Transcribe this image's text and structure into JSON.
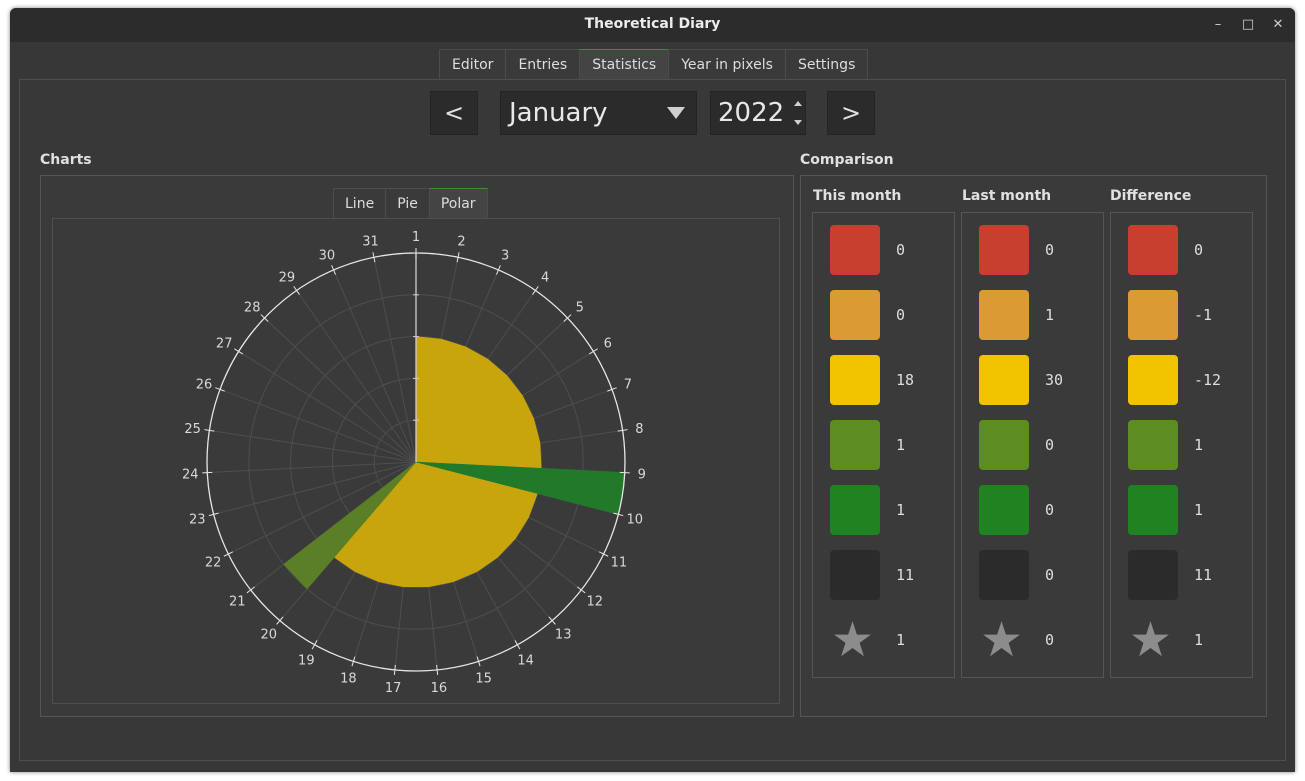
{
  "window": {
    "title": "Theoretical Diary"
  },
  "controls": {
    "minimize": "–",
    "maximize": "□",
    "close": "✕"
  },
  "tabs": [
    {
      "label": "Editor",
      "active": false
    },
    {
      "label": "Entries",
      "active": false
    },
    {
      "label": "Statistics",
      "active": true
    },
    {
      "label": "Year in pixels",
      "active": false
    },
    {
      "label": "Settings",
      "active": false
    }
  ],
  "nav": {
    "prev": "<",
    "next": ">",
    "month": "January",
    "year": "2022"
  },
  "charts": {
    "title": "Charts",
    "tabs": [
      {
        "label": "Line",
        "active": false
      },
      {
        "label": "Pie",
        "active": false
      },
      {
        "label": "Polar",
        "active": true
      }
    ]
  },
  "comparison": {
    "title": "Comparison",
    "columns": [
      {
        "title": "This month",
        "values": [
          "0",
          "0",
          "18",
          "1",
          "1",
          "11",
          "1"
        ]
      },
      {
        "title": "Last month",
        "values": [
          "0",
          "1",
          "30",
          "0",
          "0",
          "0",
          "0"
        ]
      },
      {
        "title": "Difference",
        "values": [
          "0",
          "-1",
          "-12",
          "1",
          "1",
          "11",
          "1"
        ]
      }
    ],
    "rating_colors": [
      "#c83f2f",
      "#dc9a35",
      "#f2c400",
      "#5c8c22",
      "#218222",
      "#2b2b2b"
    ],
    "star_icon": "star-icon"
  },
  "chart_data": {
    "type": "polar",
    "angular_labels": [
      "1",
      "2",
      "3",
      "4",
      "5",
      "6",
      "7",
      "8",
      "9",
      "10",
      "11",
      "12",
      "13",
      "14",
      "15",
      "16",
      "17",
      "18",
      "19",
      "20",
      "21",
      "22",
      "23",
      "24",
      "25",
      "26",
      "27",
      "28",
      "29",
      "30",
      "31"
    ],
    "radial_range": [
      0,
      5
    ],
    "grid": true,
    "series": [
      {
        "color": "#c9a50d",
        "values": [
          3,
          3,
          3,
          3,
          3,
          3,
          3,
          3,
          0,
          3,
          3,
          3,
          3,
          3,
          3,
          3,
          3,
          3,
          3,
          0,
          0,
          0,
          0,
          0,
          0,
          0,
          0,
          0,
          0,
          0,
          0
        ]
      },
      {
        "color": "#217a2a",
        "values": [
          0,
          0,
          0,
          0,
          0,
          0,
          0,
          0,
          5,
          0,
          0,
          0,
          0,
          0,
          0,
          0,
          0,
          0,
          0,
          0,
          0,
          0,
          0,
          0,
          0,
          0,
          0,
          0,
          0,
          0,
          0
        ]
      },
      {
        "color": "#5a7f27",
        "values": [
          0,
          0,
          0,
          0,
          0,
          0,
          0,
          0,
          0,
          0,
          0,
          0,
          0,
          0,
          0,
          0,
          0,
          0,
          0,
          4,
          0,
          0,
          0,
          0,
          0,
          0,
          0,
          0,
          0,
          0,
          0
        ]
      }
    ]
  }
}
